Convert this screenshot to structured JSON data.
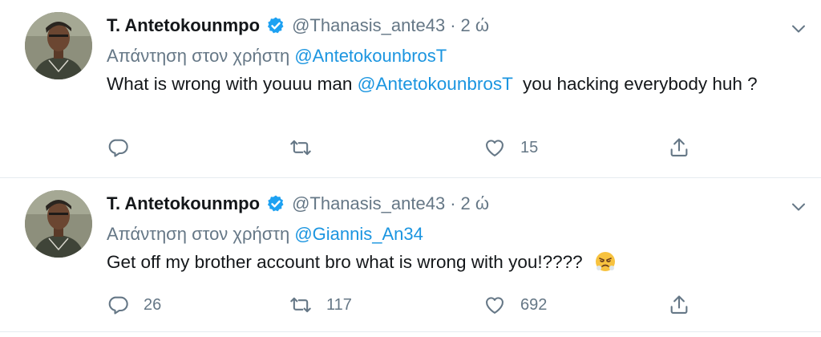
{
  "tweets": [
    {
      "name": "T. Antetokounmpo",
      "handle": "@Thanasis_ante43",
      "separator": "·",
      "time": "2 ώ",
      "reply_prefix": "Απάντηση στον χρήστη",
      "reply_to": "@AntetokounbrosT",
      "text_before": "What is wrong with youuu man",
      "text_mention": "@AntetokounbrosT",
      "text_after": "you hacking everybody huh ?",
      "replies": "",
      "retweets": "",
      "likes": "15",
      "icons": {
        "verified": "verified-badge-icon",
        "caret": "chevron-down-icon",
        "reply": "reply-icon",
        "retweet": "retweet-icon",
        "like": "heart-icon",
        "share": "share-icon"
      }
    },
    {
      "name": "T. Antetokounmpo",
      "handle": "@Thanasis_ante43",
      "separator": "·",
      "time": "2 ώ",
      "reply_prefix": "Απάντηση στον χρήστη",
      "reply_to": "@Giannis_An34",
      "text": "Get off my brother account bro what is wrong with you!????",
      "emoji": "face-with-steam-from-nose",
      "replies": "26",
      "retweets": "117",
      "likes": "692"
    }
  ],
  "colors": {
    "link": "#1b95e0",
    "secondary": "#657786",
    "verified": "#1da1f2",
    "divider": "#e6ecf0"
  }
}
